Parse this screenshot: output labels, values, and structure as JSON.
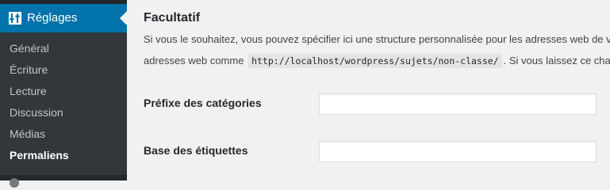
{
  "sidebar": {
    "menu_label": "Réglages",
    "menu_icon": "settings-icon",
    "items": [
      {
        "label": "Général"
      },
      {
        "label": "Écriture"
      },
      {
        "label": "Lecture"
      },
      {
        "label": "Discussion"
      },
      {
        "label": "Médias"
      },
      {
        "label": "Permaliens",
        "current": true
      }
    ]
  },
  "main": {
    "section_title": "Facultatif",
    "description_line1": "Si vous le souhaitez, vous pouvez spécifier ici une structure personnalisée pour les adresses web de vos catégories et étiquettes.",
    "description_line2_prefix": "adresses web comme",
    "description_code": "http://localhost/wordpress/sujets/non-classe/",
    "description_line2_suffix": ". Si vous laissez ce champ vide, la valeur par défaut sera utilisée.",
    "fields": [
      {
        "label": "Préfixe des catégories",
        "value": ""
      },
      {
        "label": "Base des étiquettes",
        "value": ""
      }
    ]
  },
  "colors": {
    "sidebar_bg": "#23282d",
    "submenu_bg": "#32373c",
    "accent": "#0073aa",
    "page_bg": "#f1f1f1"
  }
}
